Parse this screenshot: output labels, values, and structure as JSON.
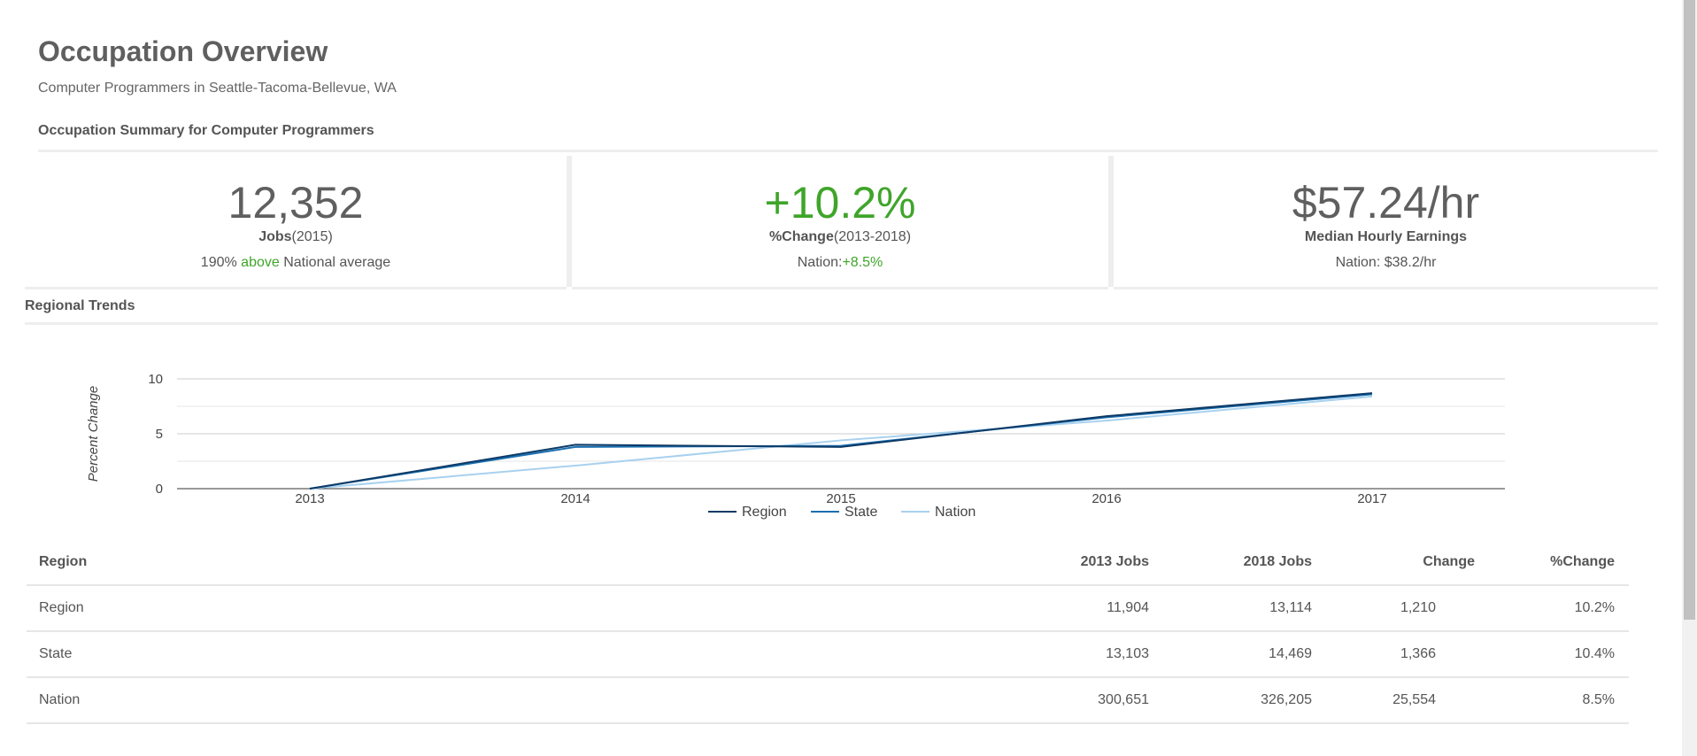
{
  "header": {
    "title": "Occupation Overview",
    "subtitle": "Computer Programmers in Seattle-Tacoma-Bellevue, WA"
  },
  "summary": {
    "heading": "Occupation Summary for Computer Programmers",
    "jobs": {
      "value": "12,352",
      "label": "Jobs",
      "label_paren": "(2015)",
      "note_prefix": "190% ",
      "note_highlight": "above",
      "note_suffix": " National average"
    },
    "change": {
      "value": "+10.2%",
      "label": "%Change",
      "label_paren": "(2013-2018)",
      "note_prefix": "Nation:",
      "note_highlight": "+8.5%"
    },
    "earnings": {
      "value": "$57.24/hr",
      "label": "Median Hourly Earnings",
      "note": "Nation: $38.2/hr"
    }
  },
  "trends": {
    "heading": "Regional Trends"
  },
  "colors": {
    "region": "#0d3a66",
    "state": "#1a6fb0",
    "nation": "#a8d1ef",
    "positive": "#3fa52a"
  },
  "chart_data": {
    "type": "line",
    "x": [
      "2013",
      "2014",
      "2015",
      "2016",
      "2017"
    ],
    "ylabel": "Percent Change",
    "ylim": [
      0,
      10
    ],
    "yticks": [
      0,
      5,
      10
    ],
    "grid": true,
    "legend_position": "bottom",
    "series": [
      {
        "name": "Region",
        "values": [
          0,
          4.0,
          3.8,
          6.6,
          8.7
        ]
      },
      {
        "name": "State",
        "values": [
          0,
          3.8,
          3.9,
          6.5,
          8.6
        ]
      },
      {
        "name": "Nation",
        "values": [
          0,
          2.1,
          4.4,
          6.2,
          8.4
        ]
      }
    ]
  },
  "table": {
    "columns": [
      "Region",
      "2013 Jobs",
      "2018 Jobs",
      "Change",
      "%Change"
    ],
    "rows": [
      [
        "Region",
        "11,904",
        "13,114",
        "1,210",
        "10.2%"
      ],
      [
        "State",
        "13,103",
        "14,469",
        "1,366",
        "10.4%"
      ],
      [
        "Nation",
        "300,651",
        "326,205",
        "25,554",
        "8.5%"
      ]
    ]
  }
}
